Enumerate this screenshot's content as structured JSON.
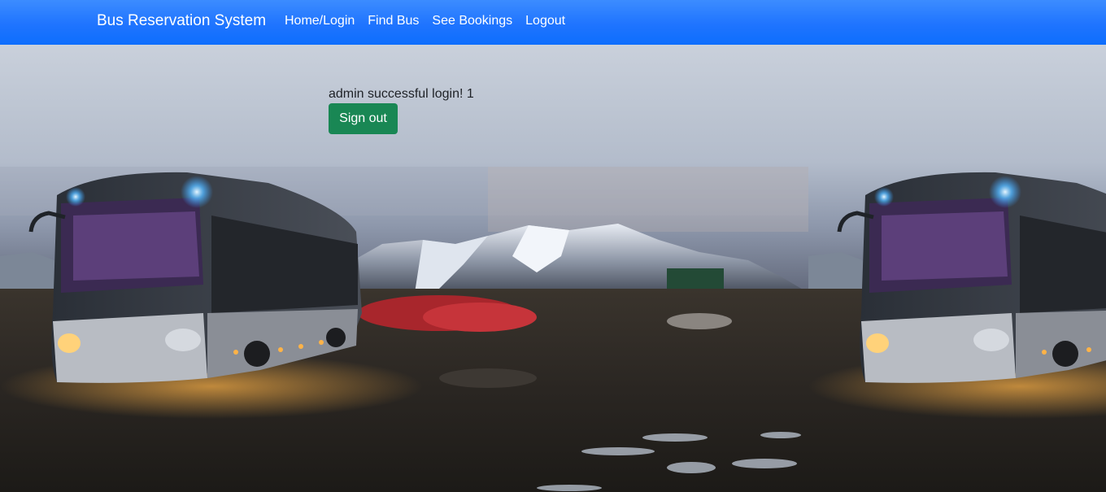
{
  "navbar": {
    "brand": "Bus Reservation System",
    "links": [
      "Home/Login",
      "Find Bus",
      "See Bookings",
      "Logout"
    ]
  },
  "login": {
    "message": "admin successful login! 1",
    "signout_label": "Sign out"
  },
  "colors": {
    "navbar": "#0d6efd",
    "signout": "#198754"
  }
}
